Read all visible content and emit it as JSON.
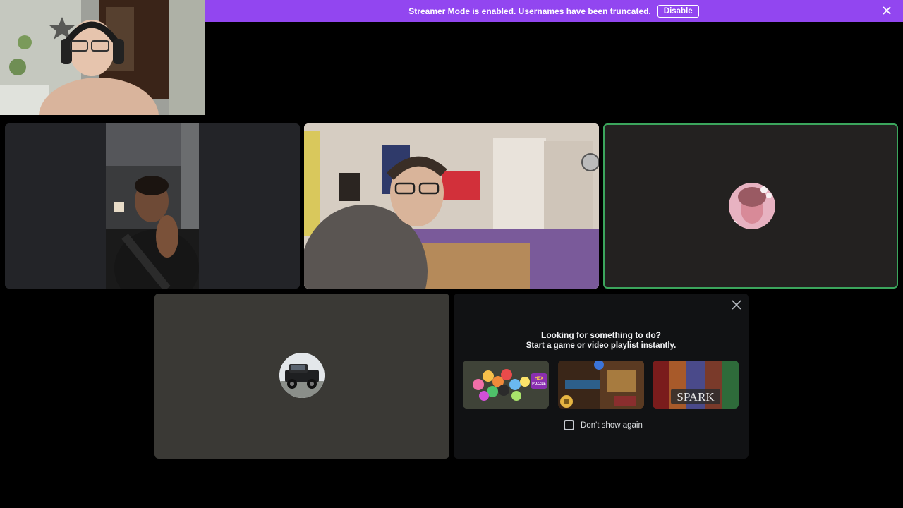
{
  "banner": {
    "message": "Streamer Mode is enabled. Usernames have been truncated.",
    "disable_label": "Disable",
    "color": "#9246f0"
  },
  "activity_panel": {
    "title": "Looking for something to do?",
    "subtitle": "Start a game or video playlist instantly.",
    "games": [
      {
        "name": "Hex Puzzle",
        "logo_text": [
          "HEX",
          "PUZZLE"
        ]
      },
      {
        "name": "Mahjong-style tavern game",
        "logo_text": []
      },
      {
        "name": "Spark",
        "logo_text": [
          "SPARK"
        ]
      }
    ],
    "dont_show_label": "Don't show again",
    "dont_show_checked": false
  },
  "speaking_indicator_color": "#3ba55c"
}
